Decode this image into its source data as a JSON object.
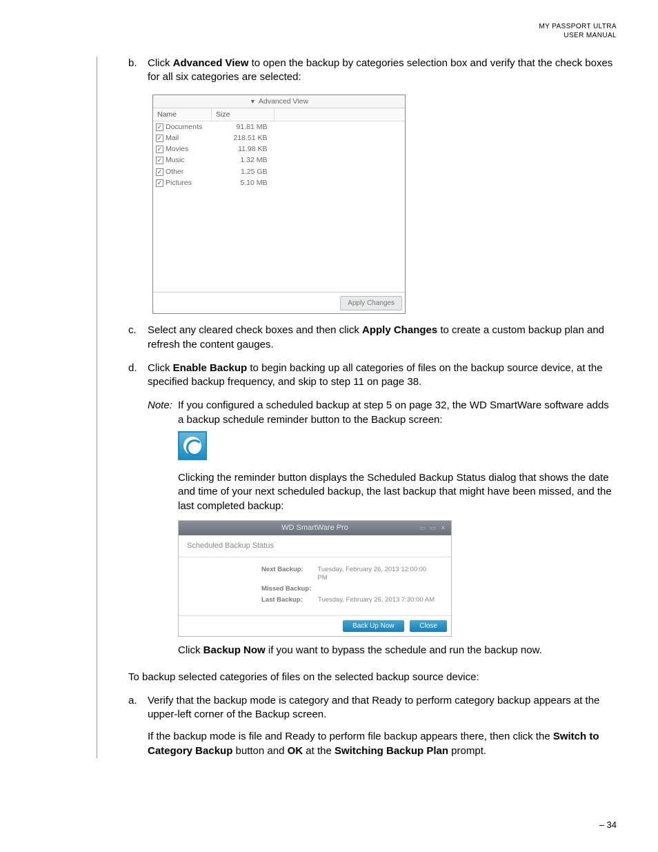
{
  "header": {
    "line1": "MY PASSPORT ULTRA",
    "line2": "USER MANUAL"
  },
  "b": {
    "marker": "b.",
    "pre": "Click ",
    "bold": "Advanced View",
    "post": " to open the backup by categories selection box and verify that the check boxes for all six categories are selected:"
  },
  "adv": {
    "title": "Advanced View",
    "col_name": "Name",
    "col_size": "Size",
    "rows": [
      {
        "name": "Documents",
        "size": "91.81 MB"
      },
      {
        "name": "Mail",
        "size": "218.51 KB"
      },
      {
        "name": "Movies",
        "size": "11.98 KB"
      },
      {
        "name": "Music",
        "size": "1.32 MB"
      },
      {
        "name": "Other",
        "size": "1.25 GB"
      },
      {
        "name": "Pictures",
        "size": "5.10 MB"
      }
    ],
    "apply": "Apply Changes"
  },
  "c": {
    "marker": "c.",
    "pre": "Select any cleared check boxes and then click ",
    "bold": "Apply Changes",
    "post": " to create a custom backup plan and refresh the content gauges."
  },
  "d": {
    "marker": "d.",
    "pre": "Click ",
    "bold": "Enable Backup",
    "post": " to begin backing up all categories of files on the backup source device, at the specified backup frequency, and skip to step 11 on page 38."
  },
  "note": {
    "label": "Note:",
    "p1": "If you configured a scheduled backup at step 5 on page 32, the WD SmartWare software adds a backup schedule reminder button to the Backup screen:",
    "p2": "Clicking the reminder button displays the Scheduled Backup Status dialog that shows the date and time of your next scheduled backup, the last backup that might have been missed, and the last completed backup:",
    "p3_pre": "Click ",
    "p3_bold": "Backup Now",
    "p3_post": " if you want to bypass the schedule and run the backup now."
  },
  "dlg": {
    "title": "WD SmartWare Pro",
    "sub": "Scheduled Backup Status",
    "next_lbl": "Next Backup:",
    "next_val": "Tuesday, February 26, 2013 12:00:00 PM",
    "missed_lbl": "Missed Backup:",
    "missed_val": "",
    "last_lbl": "Last Backup:",
    "last_val": "Tuesday, February 26, 2013 7:30:00 AM",
    "btn_backup": "Back Up Now",
    "btn_close": "Close"
  },
  "intro": "To backup selected categories of files on the selected backup source device:",
  "a": {
    "marker": "a.",
    "p1": "Verify that the backup mode is category and that Ready to perform category backup appears at the upper-left corner of the Backup screen.",
    "p2_pre": "If the backup mode is file and Ready to perform file backup appears there, then click the ",
    "p2_b1": "Switch to Category Backup",
    "p2_mid": " button and ",
    "p2_b2": "OK",
    "p2_mid2": " at the ",
    "p2_b3": "Switching Backup Plan",
    "p2_post": " prompt."
  },
  "footer": "– 34"
}
